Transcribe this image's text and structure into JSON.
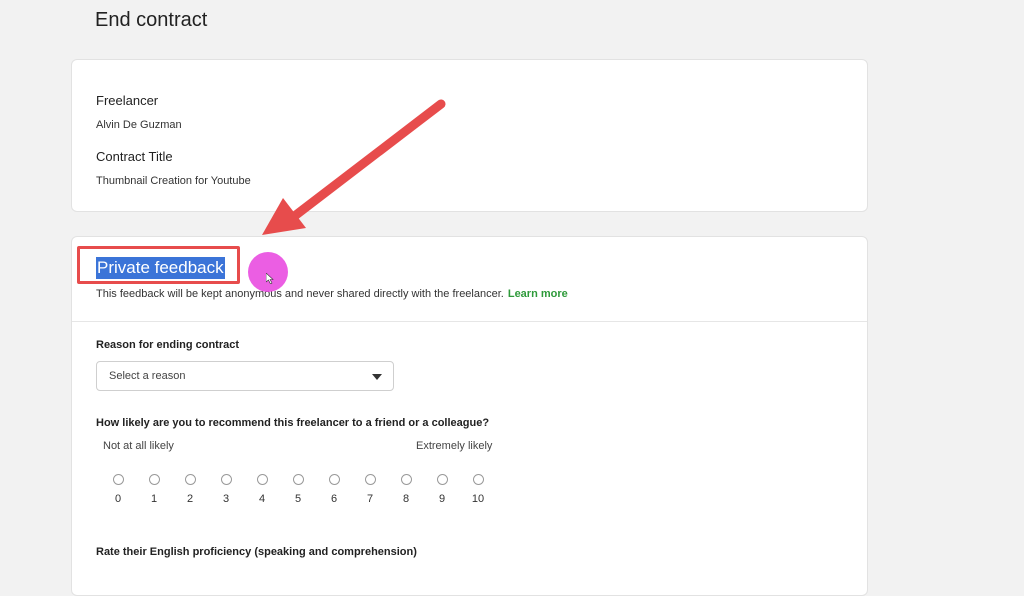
{
  "page": {
    "title": "End contract"
  },
  "contract": {
    "freelancer_label": "Freelancer",
    "freelancer_name": "Alvin De Guzman",
    "contract_title_label": "Contract Title",
    "contract_title_value": "Thumbnail Creation for Youtube"
  },
  "private_feedback": {
    "title": "Private feedback",
    "description": "This feedback will be kept anonymous and never shared directly with the freelancer.",
    "learn_more": "Learn more",
    "reason_label": "Reason for ending contract",
    "reason_placeholder": "Select a reason",
    "recommend_question": "How likely are you to recommend this freelancer to a friend or a colleague?",
    "scale_low": "Not at all likely",
    "scale_high": "Extremely likely",
    "scale": [
      "0",
      "1",
      "2",
      "3",
      "4",
      "5",
      "6",
      "7",
      "8",
      "9",
      "10"
    ],
    "english_label": "Rate their English proficiency (speaking and comprehension)"
  },
  "colors": {
    "annotation_red": "#e74c4c",
    "selection_blue": "#3b74d8",
    "link_green": "#2e9a3a",
    "cursor_pink": "#e94ce0"
  }
}
